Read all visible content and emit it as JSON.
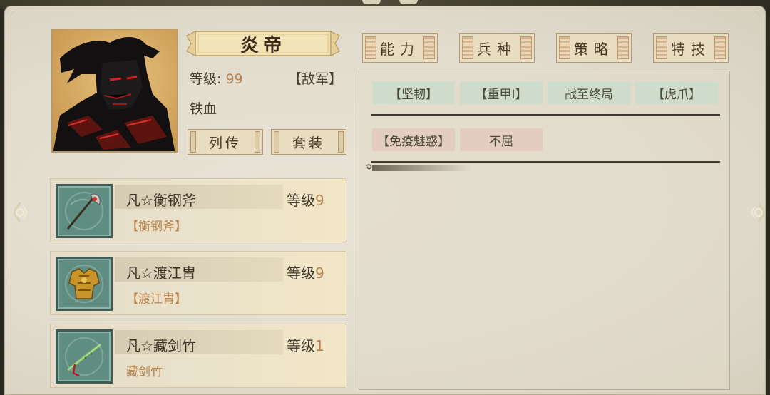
{
  "hero": {
    "name": "炎帝",
    "level_label": "等级:",
    "level_value": "99",
    "faction": "【敌军】",
    "title": "铁血",
    "buttons": {
      "biography": "列传",
      "set": "套装"
    }
  },
  "tabs": [
    "能力",
    "兵种",
    "策略",
    "特技"
  ],
  "skills": {
    "row1": [
      "【坚韧】",
      "【重甲Ⅰ】",
      "战至终局",
      "【虎爪】"
    ],
    "row2": [
      "【免疫魅惑】",
      "不屈"
    ]
  },
  "equipment": [
    {
      "name": "凡☆衡钢斧",
      "level_label": "等级",
      "level": "9",
      "tag": "【衡钢斧】",
      "icon": "axe-icon"
    },
    {
      "name": "凡☆渡江胄",
      "level_label": "等级",
      "level": "9",
      "tag": "【渡江胄】",
      "icon": "armor-icon"
    },
    {
      "name": "凡☆藏剑竹",
      "level_label": "等级",
      "level": "1",
      "tag": "藏剑竹",
      "icon": "bamboo-flute-icon"
    }
  ],
  "colors": {
    "accent_text": "#b8824c",
    "skill_green": "#cfdccc",
    "skill_pink": "#e2cdbf",
    "panel": "#e3ded0"
  },
  "icons": {
    "left_arrow": "left-arrow-icon",
    "right_arrow": "right-arrow-icon"
  }
}
